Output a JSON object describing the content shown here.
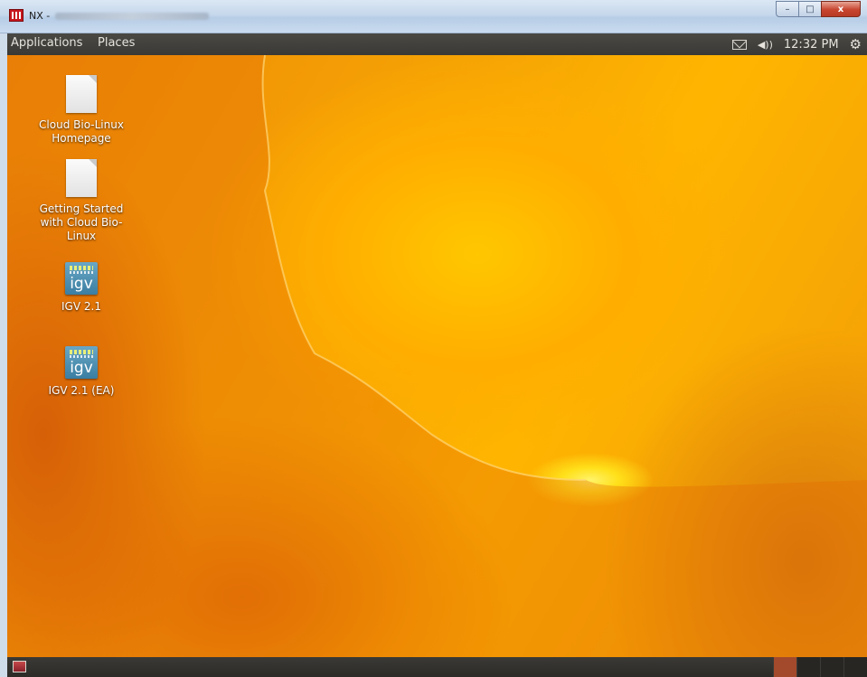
{
  "window": {
    "title_prefix": "NX -",
    "controls": {
      "minimize": "–",
      "maximize": "□",
      "close": "x"
    }
  },
  "top_panel": {
    "menus": [
      "Applications",
      "Places"
    ],
    "tray": {
      "mail_icon": "envelope-icon",
      "volume": "◀))",
      "time": "12:32 PM",
      "settings_icon": "gear-icon"
    }
  },
  "desktop_icons": [
    {
      "label": "Cloud Bio-Linux\nHomepage",
      "icon": "document-icon"
    },
    {
      "label": "Getting Started\nwith Cloud Bio-\nLinux",
      "icon": "document-icon"
    },
    {
      "label": "IGV 2.1",
      "icon": "igv-icon",
      "glyph": "igv"
    },
    {
      "label": "IGV 2.1 (EA)",
      "icon": "igv-icon",
      "glyph": "igv"
    }
  ],
  "bottom_panel": {
    "workspaces": 4,
    "active_workspace": 1
  }
}
